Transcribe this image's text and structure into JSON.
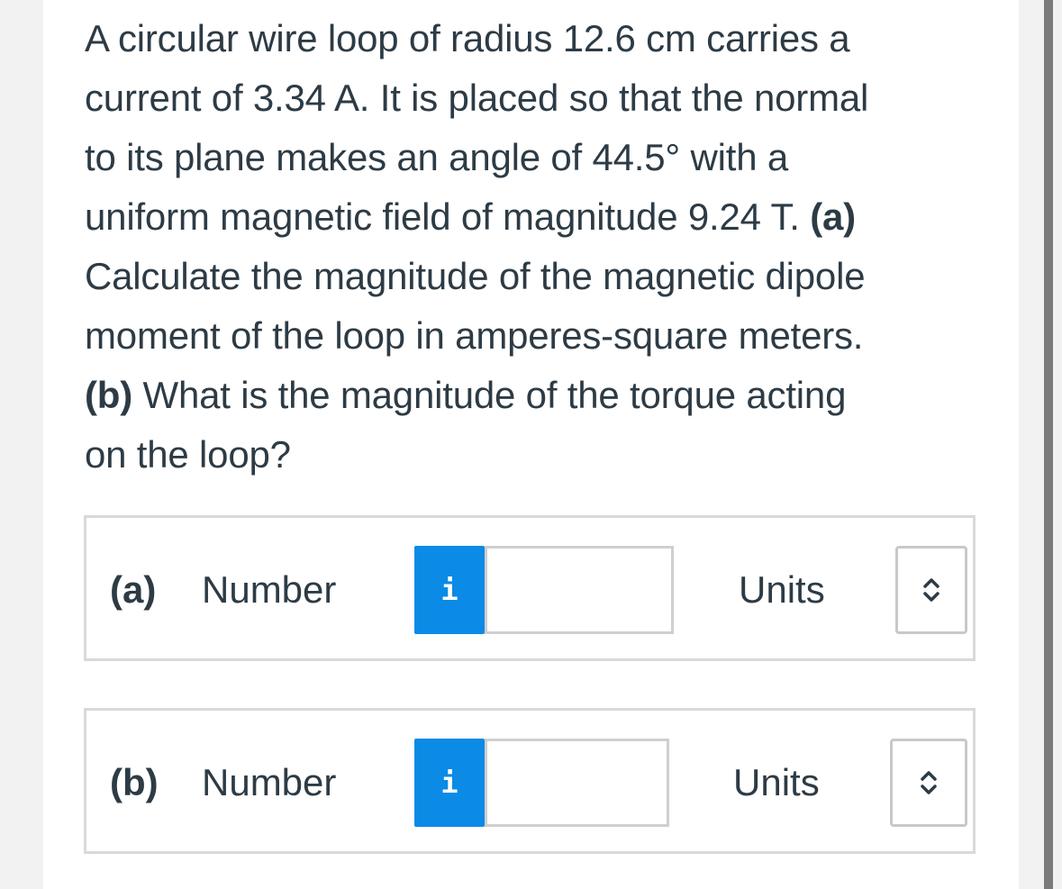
{
  "question": {
    "line1": "A circular wire loop of radius 12.6 cm carries a",
    "line2": "current of 3.34 A. It is placed so that the normal",
    "line3": "to its plane makes an angle of 44.5° with a",
    "line4_text": "uniform magnetic field of magnitude 9.24 T. ",
    "line4_bold": "(a)",
    "line5": "Calculate the magnitude of the magnetic dipole",
    "line6": "moment of the loop in amperes-square meters.",
    "line7_bold": "(b)",
    "line7_text": " What is the magnitude of the torque acting",
    "line8": "on the loop?"
  },
  "answers": [
    {
      "part": "(a)",
      "number_label": "Number",
      "info_icon": "i",
      "number_value": "",
      "units_label": "Units",
      "units_value": ""
    },
    {
      "part": "(b)",
      "number_label": "Number",
      "info_icon": "i",
      "number_value": "",
      "units_label": "Units",
      "units_value": ""
    }
  ],
  "colors": {
    "info_button": "#0b8ae6",
    "text": "#2d3b45",
    "border": "#d9d9d9"
  },
  "icons": {
    "info": "info-icon",
    "units_select": "chevron-up-down-icon"
  }
}
